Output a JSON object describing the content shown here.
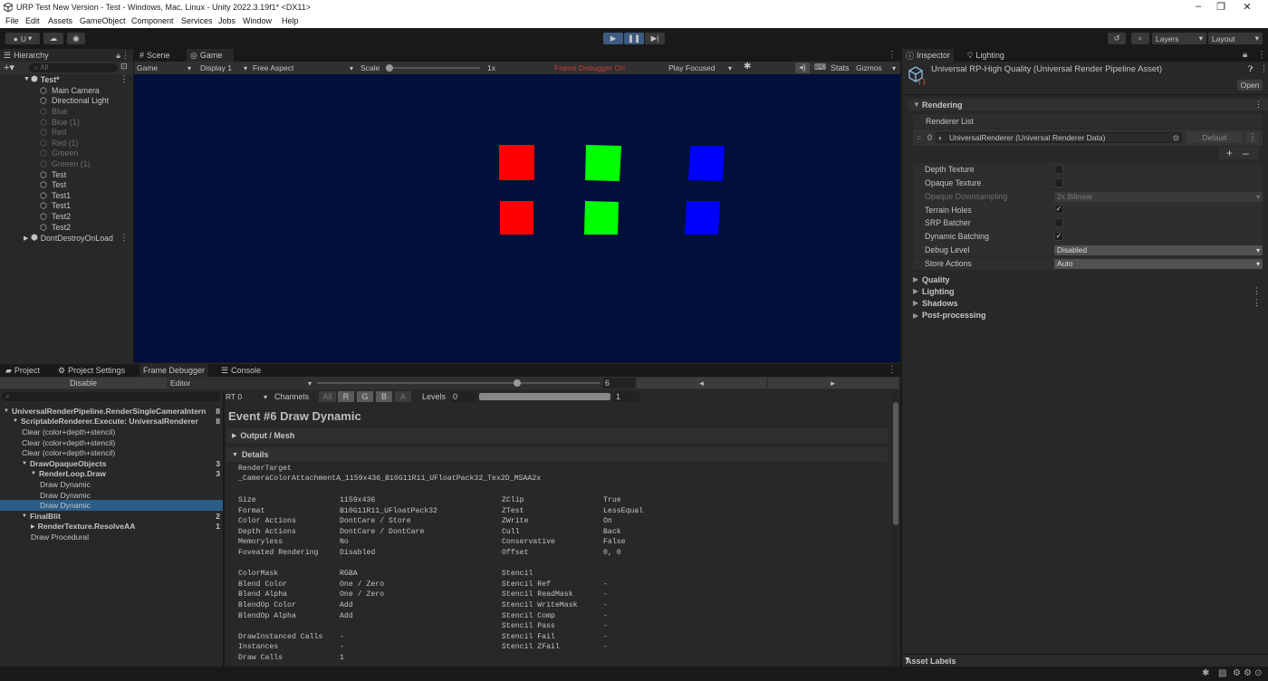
{
  "window": {
    "title": "URP Test New Version - Test - Windows, Mac, Linux - Unity 2022.3.19f1* <DX11>"
  },
  "menu": [
    "File",
    "Edit",
    "Assets",
    "GameObject",
    "Component",
    "Services",
    "Jobs",
    "Window",
    "Help"
  ],
  "toolbar": {
    "account": "U",
    "layers": "Layers",
    "layout": "Layout"
  },
  "hierarchy": {
    "tab": "Hierarchy",
    "search_placeholder": "All",
    "scene": "Test*",
    "items": [
      {
        "label": "Main Camera",
        "dim": false
      },
      {
        "label": "Directional Light",
        "dim": false
      },
      {
        "label": "Blue",
        "dim": true
      },
      {
        "label": "Blue (1)",
        "dim": true
      },
      {
        "label": "Red",
        "dim": true
      },
      {
        "label": "Red (1)",
        "dim": true
      },
      {
        "label": "Greeen",
        "dim": true
      },
      {
        "label": "Greeen (1)",
        "dim": true
      },
      {
        "label": "Test",
        "dim": false
      },
      {
        "label": "Test",
        "dim": false
      },
      {
        "label": "Test1",
        "dim": false
      },
      {
        "label": "Test1",
        "dim": false
      },
      {
        "label": "Test2",
        "dim": false
      },
      {
        "label": "Test2",
        "dim": false
      }
    ],
    "dontdestroy": "DontDestroyOnLoad"
  },
  "game": {
    "tabs": [
      "Scene",
      "Game"
    ],
    "view": "Game",
    "display": "Display 1",
    "aspect": "Free Aspect",
    "scale_label": "Scale",
    "scale_value": "1x",
    "frame_debugger": "Frame Debugger On",
    "play_mode": "Play Focused",
    "stats": "Stats",
    "gizmos": "Gizmos",
    "squares": [
      {
        "color": "#ff0000"
      },
      {
        "color": "#00ff00"
      },
      {
        "color": "#0000ff"
      },
      {
        "color": "#ff0000"
      },
      {
        "color": "#00ff00"
      },
      {
        "color": "#0000ff"
      }
    ]
  },
  "bottom": {
    "tabs": [
      "Project",
      "Project Settings",
      "Frame Debugger",
      "Console"
    ],
    "disable": "Disable",
    "editor": "Editor",
    "event_index": "6",
    "rt": "RT 0",
    "channels_label": "Channels",
    "channels": [
      "All",
      "R",
      "G",
      "B",
      "A"
    ],
    "levels_label": "Levels",
    "levels_min": "0",
    "levels_max": "1",
    "tree": [
      {
        "label": "UniversalRenderPipeline.RenderSingleCameraIntern",
        "count": "8",
        "bold": true,
        "indent": 1,
        "arrow": "▼"
      },
      {
        "label": "ScriptableRenderer.Execute: UniversalRenderer",
        "count": "8",
        "bold": true,
        "indent": 2,
        "arrow": "▼"
      },
      {
        "label": "Clear (color+depth+stencil)",
        "count": "",
        "bold": false,
        "indent": 3,
        "arrow": ""
      },
      {
        "label": "Clear (color+depth+stencil)",
        "count": "",
        "bold": false,
        "indent": 3,
        "arrow": ""
      },
      {
        "label": "Clear (color+depth+stencil)",
        "count": "",
        "bold": false,
        "indent": 3,
        "arrow": ""
      },
      {
        "label": "DrawOpaqueObjects",
        "count": "3",
        "bold": true,
        "indent": 3,
        "arrow": "▼"
      },
      {
        "label": "RenderLoop.Draw",
        "count": "3",
        "bold": true,
        "indent": 4,
        "arrow": "▼"
      },
      {
        "label": "Draw Dynamic",
        "count": "",
        "bold": false,
        "indent": 5,
        "arrow": ""
      },
      {
        "label": "Draw Dynamic",
        "count": "",
        "bold": false,
        "indent": 5,
        "arrow": ""
      },
      {
        "label": "Draw Dynamic",
        "count": "",
        "bold": false,
        "indent": 5,
        "arrow": "",
        "selected": true
      },
      {
        "label": "FinalBlit",
        "count": "2",
        "bold": true,
        "indent": 3,
        "arrow": "▼"
      },
      {
        "label": "RenderTexture.ResolveAA",
        "count": "1",
        "bold": true,
        "indent": 4,
        "arrow": "▶"
      },
      {
        "label": "Draw Procedural",
        "count": "",
        "bold": false,
        "indent": 4,
        "arrow": ""
      }
    ],
    "event_title": "Event #6 Draw Dynamic",
    "output_mesh": "Output / Mesh",
    "details": "Details",
    "render_target_label": "RenderTarget",
    "render_target": "_CameraColorAttachmentA_1159x436_B10G11R11_UFloatPack32_Tex2D_MSAA2x",
    "left_props": [
      [
        "Size",
        "1159x436"
      ],
      [
        "Format",
        "B10G11R11_UFloatPack32"
      ],
      [
        "Color Actions",
        "DontCare / Store"
      ],
      [
        "Depth Actions",
        "DontCare / DontCare"
      ],
      [
        "Memoryless",
        "No"
      ],
      [
        "Foveated Rendering",
        "Disabled"
      ],
      [
        "",
        ""
      ],
      [
        "ColorMask",
        "RGBA"
      ],
      [
        "Blend Color",
        "One / Zero"
      ],
      [
        "Blend Alpha",
        "One / Zero"
      ],
      [
        "BlendOp Color",
        "Add"
      ],
      [
        "BlendOp Alpha",
        "Add"
      ],
      [
        "",
        ""
      ],
      [
        "DrawInstanced Calls",
        "-"
      ],
      [
        "Instances",
        "-"
      ],
      [
        "Draw Calls",
        "1"
      ]
    ],
    "right_props": [
      [
        "ZClip",
        "True"
      ],
      [
        "ZTest",
        "LessEqual"
      ],
      [
        "ZWrite",
        "On"
      ],
      [
        "Cull",
        "Back"
      ],
      [
        "Conservative",
        "False"
      ],
      [
        "Offset",
        "0, 0"
      ],
      [
        "",
        ""
      ],
      [
        "Stencil",
        ""
      ],
      [
        "Stencil Ref",
        "-"
      ],
      [
        "Stencil ReadMask",
        "-"
      ],
      [
        "Stencil WriteMask",
        "-"
      ],
      [
        "Stencil Comp",
        "-"
      ],
      [
        "Stencil Pass",
        "-"
      ],
      [
        "Stencil Fail",
        "-"
      ],
      [
        "Stencil ZFail",
        "-"
      ]
    ]
  },
  "inspector": {
    "tabs": [
      "Inspector",
      "Lighting"
    ],
    "asset_title": "Universal RP-High Quality (Universal Render Pipeline Asset)",
    "open": "Open",
    "rendering": "Rendering",
    "renderer_list": "Renderer List",
    "renderer_index": "0",
    "renderer_value": "UniversalRenderer (Universal Renderer Data)",
    "default_btn": "Default",
    "props": [
      {
        "label": "Depth Texture",
        "type": "check",
        "checked": false
      },
      {
        "label": "Opaque Texture",
        "type": "check",
        "checked": false
      },
      {
        "label": "Opaque Downsampling",
        "type": "drop",
        "value": "2x Bilinear",
        "dim": true
      },
      {
        "label": "Terrain Holes",
        "type": "check",
        "checked": true
      },
      {
        "label": "SRP Batcher",
        "type": "check",
        "checked": false
      },
      {
        "label": "Dynamic Batching",
        "type": "check",
        "checked": true
      },
      {
        "label": "Debug Level",
        "type": "drop",
        "value": "Disabled"
      },
      {
        "label": "Store Actions",
        "type": "drop",
        "value": "Auto"
      }
    ],
    "sections": [
      "Quality",
      "Lighting",
      "Shadows",
      "Post-processing"
    ],
    "asset_labels": "Asset Labels"
  }
}
